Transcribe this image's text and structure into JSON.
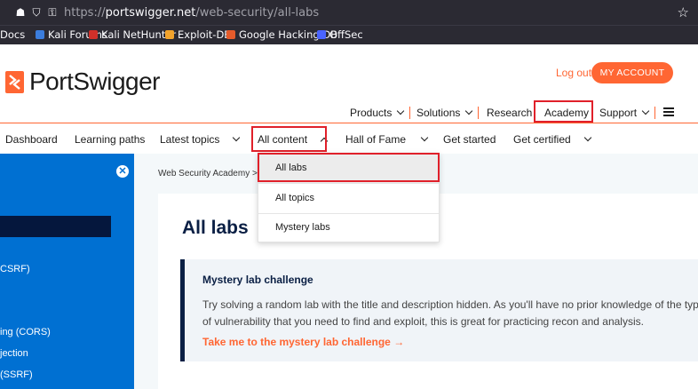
{
  "browser": {
    "url_prefix": "https://",
    "url_host": "portswigger.net",
    "url_path": "/web-security/all-labs"
  },
  "bookmarks": [
    {
      "label": "Docs",
      "color": "#ffffff"
    },
    {
      "label": "Kali Forums",
      "color": "#3b7ddd"
    },
    {
      "label": "Kali NetHunter",
      "color": "#d0302a"
    },
    {
      "label": "Exploit-DB",
      "color": "#f2a32c"
    },
    {
      "label": "Google Hacking DB",
      "color": "#e55b2b"
    },
    {
      "label": "OffSec",
      "color": "#4a64ff"
    }
  ],
  "header": {
    "logo_text": "PortSwigger",
    "logout_label": "Log out",
    "account_label": "MY ACCOUNT",
    "brand_color": "#ff6633"
  },
  "topnav": {
    "products": "Products",
    "solutions": "Solutions",
    "research": "Research",
    "academy": "Academy",
    "support": "Support"
  },
  "secnav": {
    "dashboard": "Dashboard",
    "learning_paths": "Learning paths",
    "latest_topics": "Latest topics",
    "all_content": "All content",
    "hall_of_fame": "Hall of Fame",
    "get_started": "Get started",
    "get_certified": "Get certified"
  },
  "dropdown": {
    "items": [
      "All labs",
      "All topics",
      "Mystery labs"
    ]
  },
  "sidebar": {
    "close_glyph": "✕",
    "items": [
      "CSRF)",
      "ing (CORS)",
      "jection",
      "(SSRF)"
    ]
  },
  "main": {
    "breadcrumb": "Web Security Academy",
    "breadcrumb_sep": ">",
    "title": "All labs",
    "callout": {
      "heading": "Mystery lab challenge",
      "line1": "Try solving a random lab with the title and description hidden. As you'll have no prior knowledge of the type",
      "line2": "of vulnerability that you need to find and exploit, this is great for practicing recon and analysis.",
      "link": "Take me to the mystery lab challenge →"
    }
  }
}
